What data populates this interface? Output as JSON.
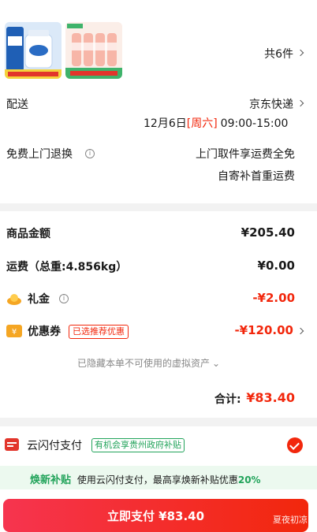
{
  "products": {
    "count_label": "共6件"
  },
  "delivery": {
    "label": "配送",
    "carrier": "京东快递",
    "date": "12月6日",
    "weekday": "[周六]",
    "time": "09:00-15:00"
  },
  "returns": {
    "label": "免费上门退换",
    "line1": "上门取件享运费全免",
    "line2": "自寄补首重运费"
  },
  "summary": {
    "goods_label": "商品金额",
    "goods_value": "¥205.40",
    "shipping_label": "运费（总重:4.856kg）",
    "shipping_value": "¥0.00",
    "gift_label": "礼金",
    "gift_value": "-¥2.00",
    "coupon_label": "优惠券",
    "coupon_tag": "已选推荐优惠",
    "coupon_value": "-¥120.00",
    "hidden_assets": "已隐藏本单不可使用的虚拟资产",
    "total_label": "合计:",
    "total_value": "¥83.40"
  },
  "payment": {
    "method": "云闪付支付",
    "tag": "有机会享贵州政府补贴"
  },
  "promo": {
    "title": "焕新补贴",
    "text": "使用云闪付支付，最高享焕新补贴优惠",
    "percent": "20%"
  },
  "checkout": {
    "button": "立即支付 ¥83.40",
    "corner_note": "夏夜初凉"
  },
  "colors": {
    "accent_red": "#f2270c",
    "green": "#21a35a"
  }
}
